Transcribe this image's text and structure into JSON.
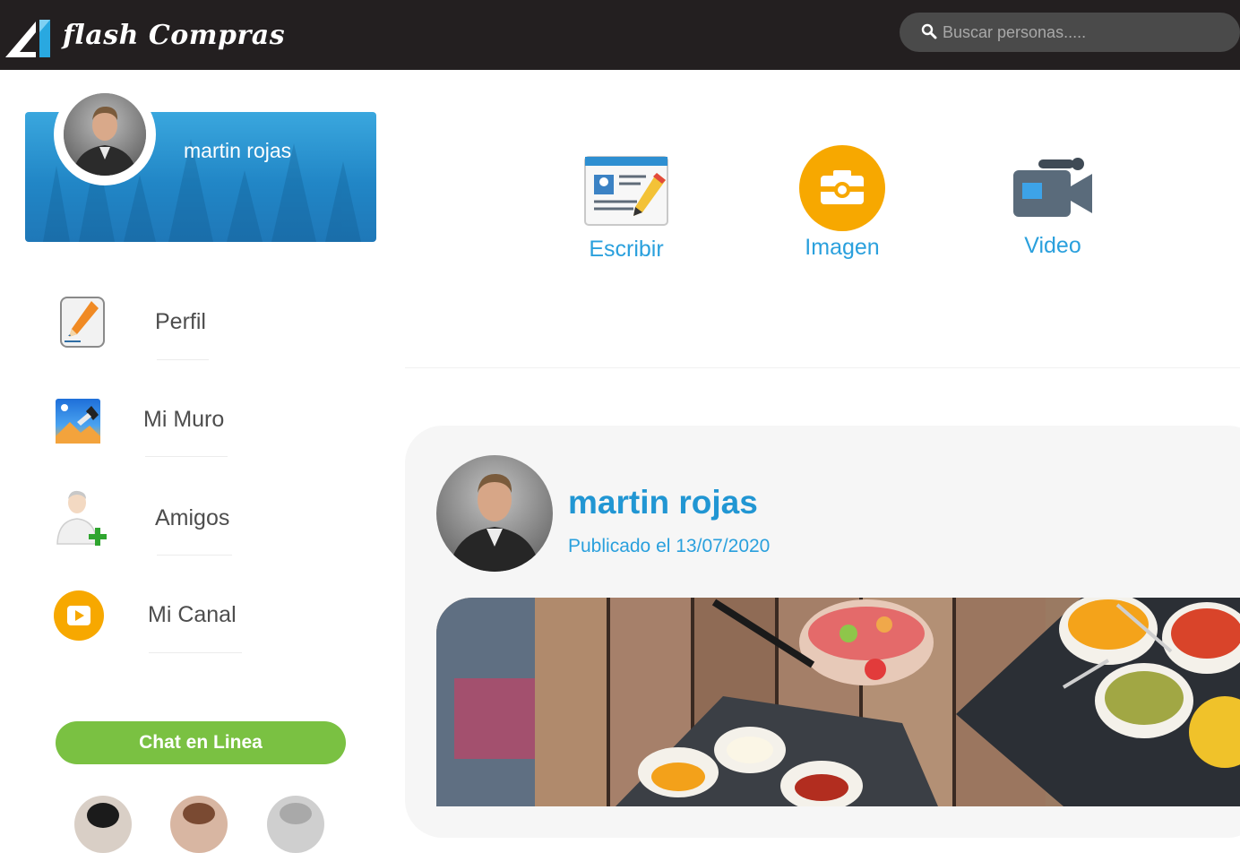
{
  "header": {
    "brand": "flash Compras",
    "search_placeholder": "Buscar personas.....",
    "colors": {
      "bar": "#231f20",
      "search_bg": "#4a4a4a"
    }
  },
  "profile": {
    "name": "martin rojas",
    "banner_color": "#2186c6"
  },
  "menu": {
    "items": [
      {
        "label": "Perfil",
        "icon": "pencil-edit-icon"
      },
      {
        "label": "Mi Muro",
        "icon": "wall-picture-icon"
      },
      {
        "label": "Amigos",
        "icon": "add-friend-icon"
      },
      {
        "label": "Mi Canal",
        "icon": "channel-play-icon"
      }
    ],
    "chat_button": "Chat en Linea",
    "chat_color": "#7ac142"
  },
  "composer": {
    "write_label": "Escribir",
    "image_label": "Imagen",
    "video_label": "Video",
    "accent": "#2aa0dd"
  },
  "post": {
    "author": "martin rojas",
    "date": "Publicado el 13/07/2020",
    "image": "food-table-photo"
  }
}
